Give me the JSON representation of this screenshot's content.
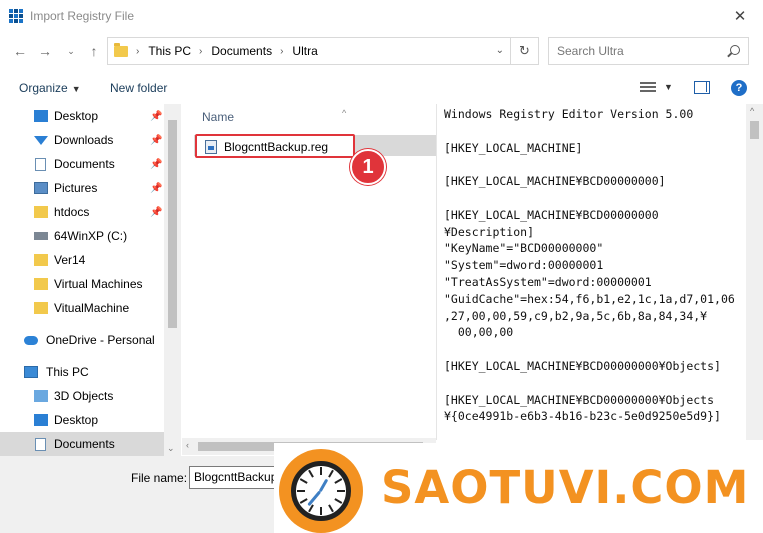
{
  "window": {
    "title": "Import Registry File"
  },
  "nav": {
    "breadcrumb": [
      "This PC",
      "Documents",
      "Ultra"
    ],
    "search_placeholder": "Search Ultra"
  },
  "toolbar": {
    "organize_label": "Organize",
    "new_folder_label": "New folder"
  },
  "sidebar": {
    "items": [
      {
        "label": "Desktop",
        "icon": "desktop-icon",
        "pinned": true
      },
      {
        "label": "Downloads",
        "icon": "downloads-icon",
        "pinned": true
      },
      {
        "label": "Documents",
        "icon": "documents-icon",
        "pinned": true
      },
      {
        "label": "Pictures",
        "icon": "pictures-icon",
        "pinned": true
      },
      {
        "label": "htdocs",
        "icon": "folder-icon",
        "pinned": true
      },
      {
        "label": "64WinXP  (C:)",
        "icon": "drive-icon",
        "pinned": false
      },
      {
        "label": "Ver14",
        "icon": "folder-icon",
        "pinned": false
      },
      {
        "label": "Virtual Machines",
        "icon": "folder-icon",
        "pinned": false
      },
      {
        "label": "VitualMachine",
        "icon": "folder-icon",
        "pinned": false
      },
      {
        "label": "OneDrive - Personal",
        "icon": "onedrive-icon",
        "pinned": false
      },
      {
        "label": "This PC",
        "icon": "this-pc-icon",
        "pinned": false
      },
      {
        "label": "3D Objects",
        "icon": "3d-objects-icon",
        "pinned": false
      },
      {
        "label": "Desktop",
        "icon": "desktop-icon",
        "pinned": false
      },
      {
        "label": "Documents",
        "icon": "documents-icon",
        "pinned": false,
        "selected": true
      }
    ]
  },
  "filelist": {
    "column_name": "Name",
    "files": [
      {
        "name": "BlogcnttBackup.reg"
      }
    ]
  },
  "annotation": {
    "step": "1"
  },
  "preview": {
    "lines": [
      "Windows Registry Editor Version 5.00",
      "",
      "[HKEY_LOCAL_MACHINE]",
      "",
      "[HKEY_LOCAL_MACHINE¥BCD00000000]",
      "",
      "[HKEY_LOCAL_MACHINE¥BCD00000000",
      "¥Description]",
      "\"KeyName\"=\"BCD00000000\"",
      "\"System\"=dword:00000001",
      "\"TreatAsSystem\"=dword:00000001",
      "\"GuidCache\"=hex:54,f6,b1,e2,1c,1a,d7,01,06",
      ",27,00,00,59,c9,b2,9a,5c,6b,8a,84,34,¥",
      "  00,00,00",
      "",
      "[HKEY_LOCAL_MACHINE¥BCD00000000¥Objects]",
      "",
      "[HKEY_LOCAL_MACHINE¥BCD00000000¥Objects",
      "¥{0ce4991b-e6b3-4b16-b23c-5e0d9250e5d9}]"
    ]
  },
  "bottom": {
    "file_name_label": "File name:",
    "file_name_value": "BlogcnttBackup"
  },
  "watermark": {
    "brand": "SAOTUVI.COM"
  }
}
